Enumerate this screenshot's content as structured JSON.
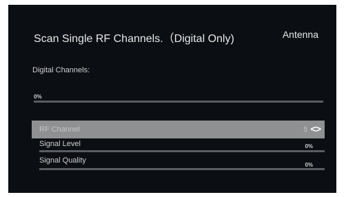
{
  "header": {
    "title": "Scan Single RF Channels.（Digital Only)",
    "source": "Antenna"
  },
  "digital": {
    "label": "Digital Channels:",
    "progress_text": "0%",
    "progress_value": 0
  },
  "rf_channel": {
    "label": "RF Channel",
    "value": "5",
    "arrows_glyph": "<>"
  },
  "signal_level": {
    "label": "Signal Level",
    "value_text": "0%",
    "value": 0
  },
  "signal_quality": {
    "label": "Signal Quality",
    "value_text": "0%",
    "value": 0
  },
  "colors": {
    "screen_bg": "#0b0e13",
    "highlight_row": "#8f9092",
    "track": "#5a5e64"
  }
}
